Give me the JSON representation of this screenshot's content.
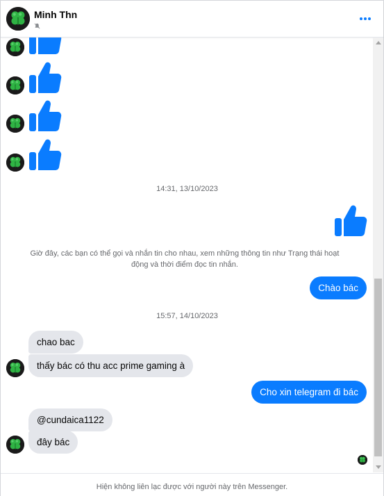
{
  "header": {
    "contact_name": "Minh Thn",
    "status_icon": "muted-bell-icon",
    "menu_icon": "more-options-icon"
  },
  "avatar_icon": "four-leaf-clover-icon",
  "colors": {
    "accent": "#0a7cff",
    "incoming_bubble": "#e4e6eb",
    "outgoing_text": "#ffffff",
    "avatar_bg": "#1a1a1a",
    "clover": "#2fb344"
  },
  "conversation": {
    "timestamps": [
      "14:31, 13/10/2023",
      "15:57, 14/10/2023"
    ],
    "system_note": "Giờ đây, các bạn có thể gọi và nhắn tin cho nhau, xem những thông tin như Trạng thái hoạt động và thời điểm đọc tin nhắn.",
    "messages": [
      {
        "sender": "them",
        "type": "like"
      },
      {
        "sender": "them",
        "type": "like"
      },
      {
        "sender": "them",
        "type": "like"
      },
      {
        "sender": "them",
        "type": "like"
      },
      {
        "sender": "me",
        "type": "like"
      },
      {
        "sender": "me",
        "type": "text",
        "text": "Chào bác"
      },
      {
        "sender": "them",
        "type": "text",
        "text": "chao bac"
      },
      {
        "sender": "them",
        "type": "text",
        "text": "thấy bác có thu acc prime gaming à"
      },
      {
        "sender": "me",
        "type": "text",
        "text": "Cho xin telegram đi bác"
      },
      {
        "sender": "them",
        "type": "text",
        "text": "@cundaica1122"
      },
      {
        "sender": "them",
        "type": "text",
        "text": "đây bác"
      }
    ]
  },
  "footer": {
    "notice": "Hiện không liên lạc được với người này trên Messenger."
  }
}
